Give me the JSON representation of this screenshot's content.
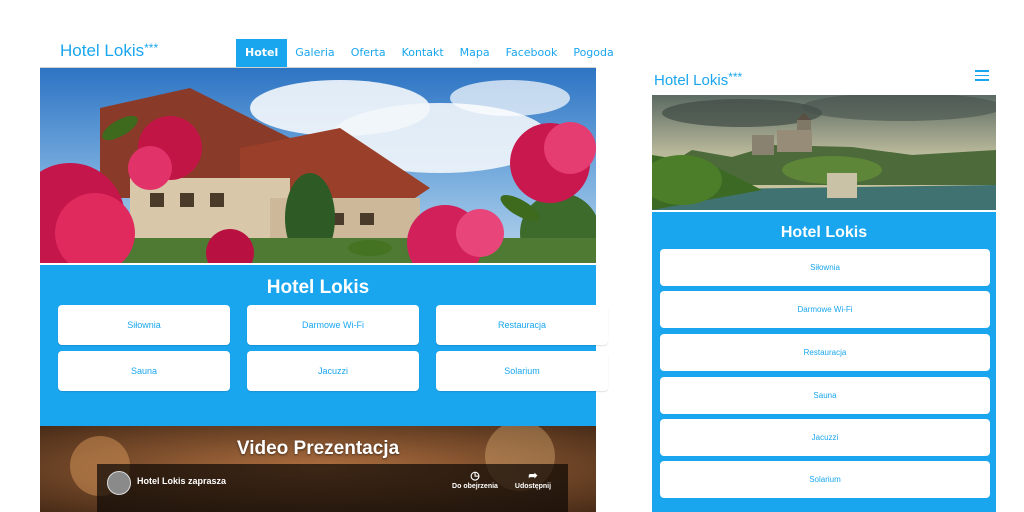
{
  "desktop": {
    "brand": "Hotel Lokis",
    "brand_stars": "***",
    "nav": [
      "Hotel",
      "Galeria",
      "Oferta",
      "Kontakt",
      "Mapa",
      "Facebook",
      "Pogoda"
    ],
    "active_nav": "Hotel",
    "section_title": "Hotel Lokis",
    "amenities": [
      "Siłownia",
      "Darmowe Wi-Fi",
      "Restauracja",
      "Sauna",
      "Jacuzzi",
      "Solarium"
    ],
    "video_section_title": "Video Prezentacja",
    "video": {
      "title": "Hotel Lokis zaprasza",
      "watch_later": "Do obejrzenia",
      "share": "Udostępnij"
    }
  },
  "mobile": {
    "brand": "Hotel Lokis",
    "brand_stars": "***",
    "section_title": "Hotel Lokis",
    "amenities": [
      "Siłownia",
      "Darmowe Wi-Fi",
      "Restauracja",
      "Sauna",
      "Jacuzzi",
      "Solarium"
    ]
  },
  "colors": {
    "accent": "#1aa6ee",
    "white": "#ffffff"
  },
  "icons": {
    "menu": "hamburger-icon",
    "watch_later": "clock-icon",
    "share": "share-arrow-icon"
  }
}
